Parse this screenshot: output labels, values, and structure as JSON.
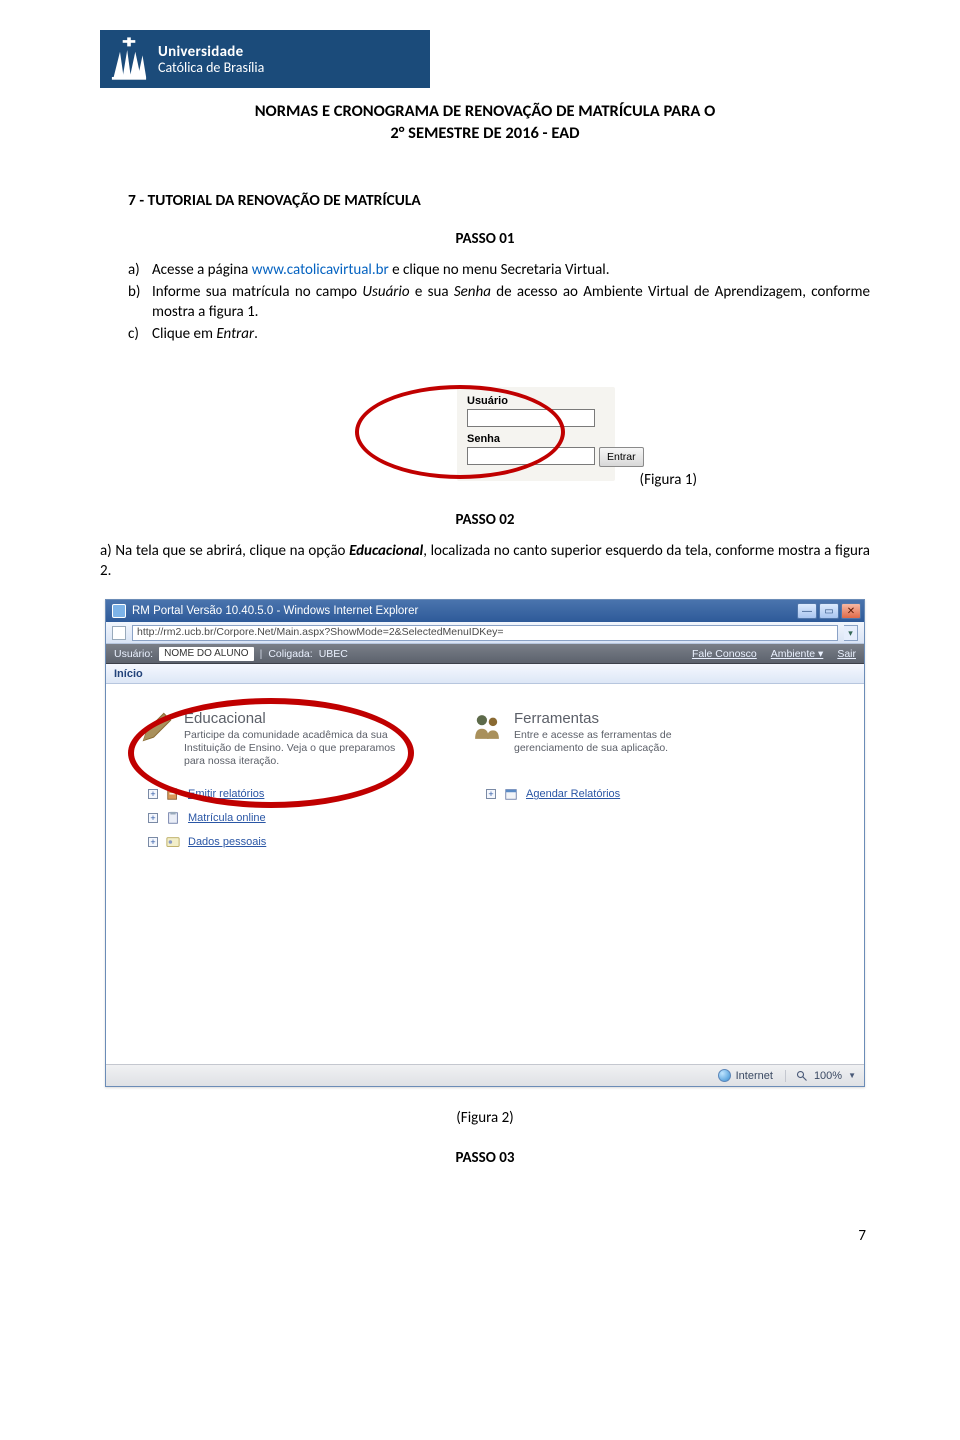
{
  "header": {
    "brand_line1": "Universidade",
    "brand_line2": "Católica de Brasília"
  },
  "doc_title_line1": "NORMAS E CRONOGRAMA DE RENOVAÇÃO DE MATRÍCULA PARA O",
  "doc_title_line2": "2° SEMESTRE DE 2016 - EAD",
  "section7_heading": "7 - TUTORIAL DA RENOVAÇÃO DE MATRÍCULA",
  "passo01_label": "PASSO 01",
  "list_a": {
    "marker": "a)",
    "t1": "Acesse a página ",
    "link": "www.catolicavirtual.br",
    "t2": " e clique no menu Secretaria Virtual."
  },
  "list_b": {
    "marker": "b)",
    "t1": "Informe sua matrícula no campo ",
    "i1": "Usuário",
    "t2": " e sua ",
    "i2": "Senha",
    "t3": " de acesso ao Ambiente Virtual de Aprendizagem, conforme mostra a figura 1."
  },
  "list_c": {
    "marker": "c)",
    "t1": "Clique em ",
    "i1": "Entrar",
    "t2": "."
  },
  "login": {
    "user_label": "Usuário",
    "pass_label": "Senha",
    "button": "Entrar"
  },
  "fig1_caption": "(Figura 1)",
  "passo02_label": "PASSO 02",
  "para_a": {
    "t1": "a) Na tela que se abrirá, clique na opção ",
    "b1": "Educacional",
    "t2": ", localizada no canto superior esquerdo da tela, conforme mostra a figura 2."
  },
  "ie": {
    "title": "RM Portal Versão 10.40.5.0 - Windows Internet Explorer",
    "address": "http://rm2.ucb.br/Corpore.Net/Main.aspx?ShowMode=2&SelectedMenuIDKey=",
    "user_label": "Usuário:",
    "user_value": "NOME DO ALUNO",
    "coligada_label": "Coligada:",
    "coligada_value": "UBEC",
    "link_fale": "Fale Conosco",
    "link_amb": "Ambiente ▾",
    "link_sair": "Sair",
    "menu_inicio": "Início",
    "tile_edu_title": "Educacional",
    "tile_edu_desc": "Participe da comunidade acadêmica da sua Instituição de Ensino. Veja o que preparamos para nossa iteração.",
    "tile_tools_title": "Ferramentas",
    "tile_tools_desc": "Entre e acesse as ferramentas de gerenciamento de sua aplicação.",
    "sub_emitir": "Emitir relatórios",
    "sub_matricula": "Matrícula online",
    "sub_dados": "Dados pessoais",
    "sub_agendar": "Agendar Relatórios",
    "status_internet": "Internet",
    "status_zoom": "100%"
  },
  "fig2_caption": "(Figura 2)",
  "passo03_label": "PASSO 03",
  "page_number": "7"
}
